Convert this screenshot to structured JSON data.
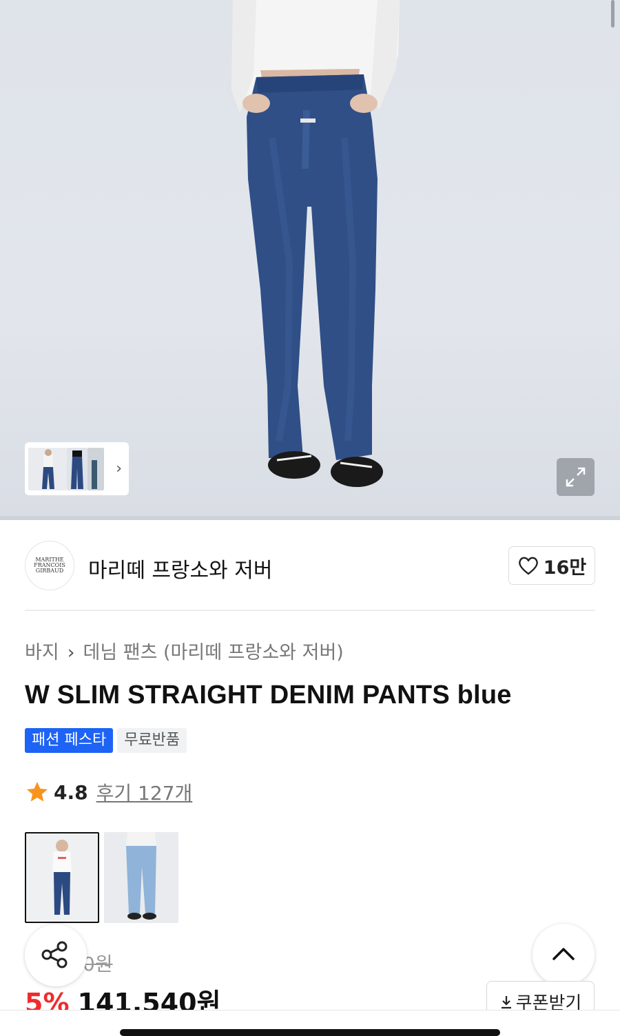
{
  "gallery": {
    "thumbnail_count": 3,
    "next_label": "›",
    "expand_icon": "expand-arrows-icon"
  },
  "brand": {
    "logo_text_lines": [
      "MARITHE",
      "FRANCOIS",
      "GIRBAUD"
    ],
    "name": "마리떼 프랑소와 저버",
    "like_count": "16만"
  },
  "breadcrumb": {
    "items": [
      "바지",
      "데님 팬츠 (마리떼 프랑소와 저버)"
    ],
    "separator": "›"
  },
  "product": {
    "title": "W SLIM STRAIGHT DENIM PANTS blue",
    "tags": [
      {
        "label": "패션 페스타",
        "color": "#1d63f5"
      },
      {
        "label": "무료반품",
        "color": "#f1f2f4"
      }
    ],
    "rating": "4.8",
    "reviews": "후기 127개",
    "original_price_partial": "0원",
    "discount": "5%",
    "price": "141,540원"
  },
  "actions": {
    "coupon_label": "쿠폰받기",
    "coupon_icon": "download-arrow-icon",
    "share_icon": "share-icon",
    "scroll_top_icon": "chevron-up-icon"
  },
  "colors": {
    "accent_blue": "#1d63f5",
    "discount_red": "#ef2b2b",
    "star": "#f7941d"
  }
}
